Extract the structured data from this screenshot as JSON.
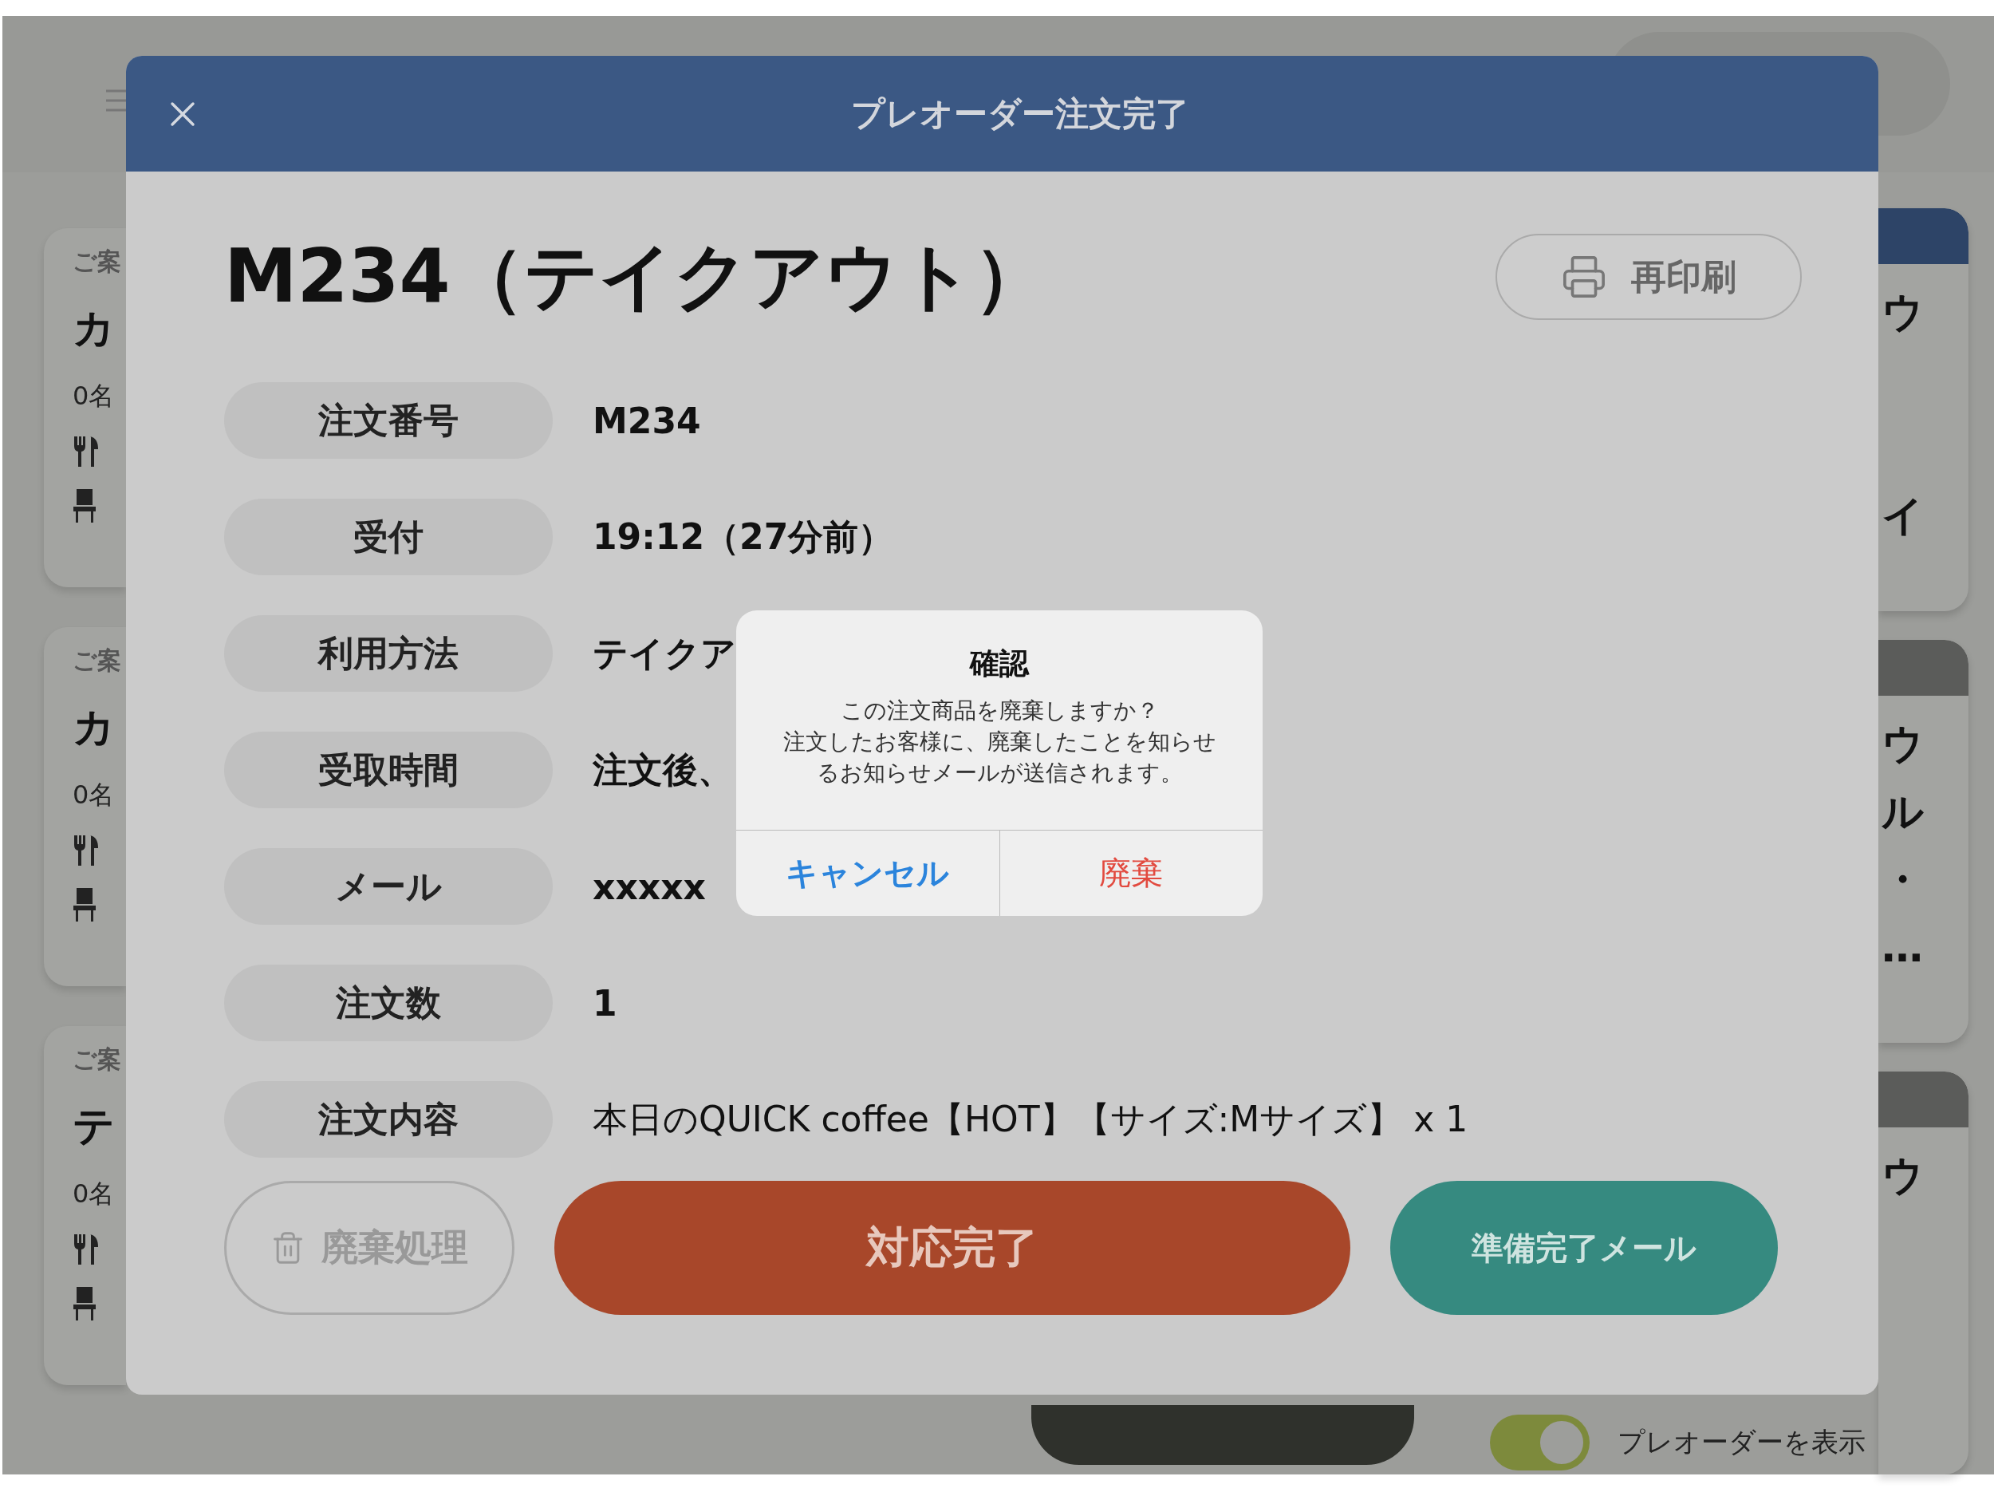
{
  "background": {
    "left_cards": [
      {
        "heading": "ご案",
        "title": "カ",
        "count": "0名"
      },
      {
        "heading": "ご案",
        "title": "カ",
        "count": "0名"
      },
      {
        "heading": "ご案",
        "title": "テ",
        "count": "0名"
      }
    ],
    "right_cards": [
      {
        "color": "#2d4467",
        "lines": [
          "ウ",
          "イ"
        ]
      },
      {
        "color": "#5b5c5a",
        "lines": [
          "ウ",
          "ル",
          "・",
          "…"
        ]
      },
      {
        "color": "#5b5c5a",
        "lines": [
          "ウ"
        ]
      }
    ],
    "preorder_toggle": {
      "label": "プレオーダーを表示",
      "on": true
    }
  },
  "modal": {
    "title": "プレオーダー注文完了",
    "heading": "M234（テイクアウト）",
    "reprint_button": "再印刷",
    "rows": [
      {
        "label": "注文番号",
        "value": "M234",
        "kind": "bold"
      },
      {
        "label": "受付",
        "value": "19:12（27分前）",
        "kind": "bold"
      },
      {
        "label": "利用方法",
        "value": "テイクア",
        "kind": "bold"
      },
      {
        "label": "受取時間",
        "value": "注文後、",
        "kind": "bold"
      },
      {
        "label": "メール",
        "value": "xxxxx",
        "kind": "bold"
      },
      {
        "label": "注文数",
        "value": "1",
        "kind": "bold"
      },
      {
        "label": "注文内容",
        "value": "本日のQUICK coffee【HOT】【サイズ:Mサイズ】 x 1",
        "kind": "plain"
      }
    ],
    "buttons": [
      {
        "label": "廃棄処理",
        "kind": "discard",
        "disabled": true
      },
      {
        "label": "対応完了",
        "kind": "primary",
        "disabled": false
      },
      {
        "label": "準備完了メール",
        "kind": "mail",
        "disabled": false
      }
    ]
  },
  "alert": {
    "title": "確認",
    "message": [
      "この注文商品を廃棄しますか？",
      "注文したお客様に、廃棄したことを知らせるお知らせメールが送信されます。"
    ],
    "buttons": [
      {
        "label": "キャンセル",
        "kind": "cancel"
      },
      {
        "label": "廃棄",
        "kind": "destructive"
      }
    ]
  }
}
